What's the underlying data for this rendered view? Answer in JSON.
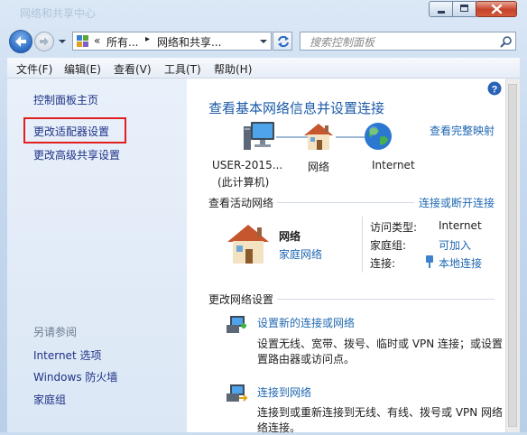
{
  "window": {
    "title": "网络和共享中心"
  },
  "nav": {
    "breadcrumb_prefix": "«",
    "breadcrumb_1": "所有...",
    "breadcrumb_sep": "▸",
    "breadcrumb_2": "网络和共享...",
    "search_placeholder": "搜索控制面板"
  },
  "menu": [
    "文件(F)",
    "编辑(E)",
    "查看(V)",
    "工具(T)",
    "帮助(H)"
  ],
  "sidebar": {
    "home": "控制面板主页",
    "adapter": "更改适配器设置",
    "sharing": "更改高级共享设置",
    "see_also": "另请参阅",
    "internet_options": "Internet 选项",
    "firewall": "Windows 防火墙",
    "homegroup": "家庭组"
  },
  "main": {
    "heading": "查看基本网络信息并设置连接",
    "full_map": "查看完整映射",
    "map": {
      "computer_line1": "USER-2015...",
      "computer_line2": "(此计算机)",
      "network": "网络",
      "internet": "Internet"
    },
    "active_title": "查看活动网络",
    "connect_disconnect": "连接或断开连接",
    "network_name": "网络",
    "network_type": "家庭网络",
    "access_type_label": "访问类型:",
    "access_type_value": "Internet",
    "homegroup_label": "家庭组:",
    "homegroup_value": "可加入",
    "connections_label": "连接:",
    "connections_value": "本地连接",
    "change_title": "更改网络设置",
    "task1_title": "设置新的连接或网络",
    "task1_desc_1": "设置无线、宽带、拨号、临时或 VPN 连接；或设置",
    "task1_desc_2": "置路由器或访问点。",
    "task2_title": "连接到网络",
    "task2_desc_1": "连接到或重新连接到无线、有线、拨号或 VPN 网络",
    "task2_desc_2": "络连接。"
  },
  "colors": {
    "link": "#1f67b1",
    "heading": "#1a5aa8",
    "highlight_box": "#e02020"
  }
}
